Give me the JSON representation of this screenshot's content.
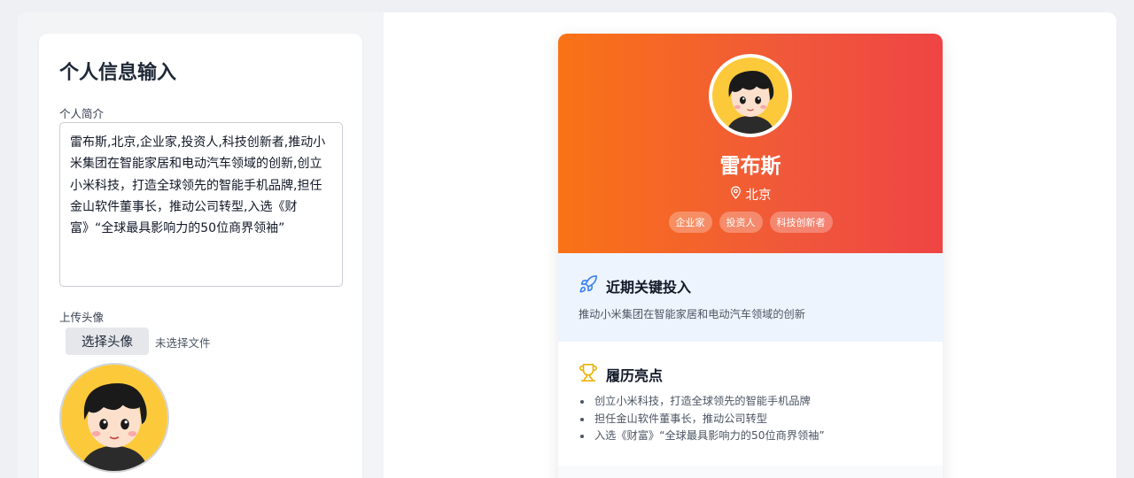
{
  "form": {
    "title": "个人信息输入",
    "bio_label": "个人简介",
    "bio_value": "雷布斯,北京,企业家,投资人,科技创新者,推动小米集团在智能家居和电动汽车领域的创新,创立小米科技，打造全球领先的智能手机品牌,担任金山软件董事长，推动公司转型,入选《财富》“全球最具影响力的50位商界领袖”",
    "avatar_label": "上传头像",
    "choose_button": "选择头像",
    "no_file_text": "未选择文件"
  },
  "profile": {
    "name": "雷布斯",
    "location": "北京",
    "tags": [
      "企业家",
      "投资人",
      "科技创新者"
    ],
    "invest": {
      "title": "近期关键投入",
      "text": "推动小米集团在智能家居和电动汽车领域的创新"
    },
    "history": {
      "title": "履历亮点",
      "items": [
        "创立小米科技，打造全球领先的智能手机品牌",
        "担任金山软件董事长，推动公司转型",
        "入选《财富》“全球最具影响力的50位商界领袖”"
      ]
    }
  },
  "colors": {
    "hero_gradient_start": "#f97316",
    "hero_gradient_end": "#ef4444",
    "invest_bg": "#eef4fd",
    "rocket_icon": "#3b82f6",
    "trophy_icon": "#eab308"
  },
  "icons": {
    "location": "map-pin-icon",
    "invest": "rocket-icon",
    "history": "trophy-icon"
  }
}
